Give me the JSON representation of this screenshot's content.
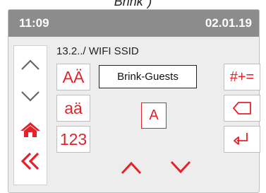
{
  "caption": "Brink\")",
  "status_bar": {
    "time": "11:09",
    "date": "02.01.19"
  },
  "breadcrumb": "13.2../ WIFI SSID",
  "input": {
    "value": "Brink-Guests"
  },
  "keys": {
    "upper_case": "AÄ",
    "lower_case": "aä",
    "numeric": "123",
    "symbols": "#+=",
    "current_char": "A"
  },
  "icons": {
    "scroll_up": "chevron-up-icon",
    "scroll_down": "chevron-down-icon",
    "home": "home-icon",
    "back": "double-chevron-left-icon",
    "backspace": "backspace-icon",
    "enter": "enter-icon",
    "char_up": "chevron-up-icon",
    "char_down": "chevron-down-icon"
  },
  "colors": {
    "accent": "#e5222a",
    "status_bar": "#8c8c8c",
    "panel": "#ededed"
  }
}
